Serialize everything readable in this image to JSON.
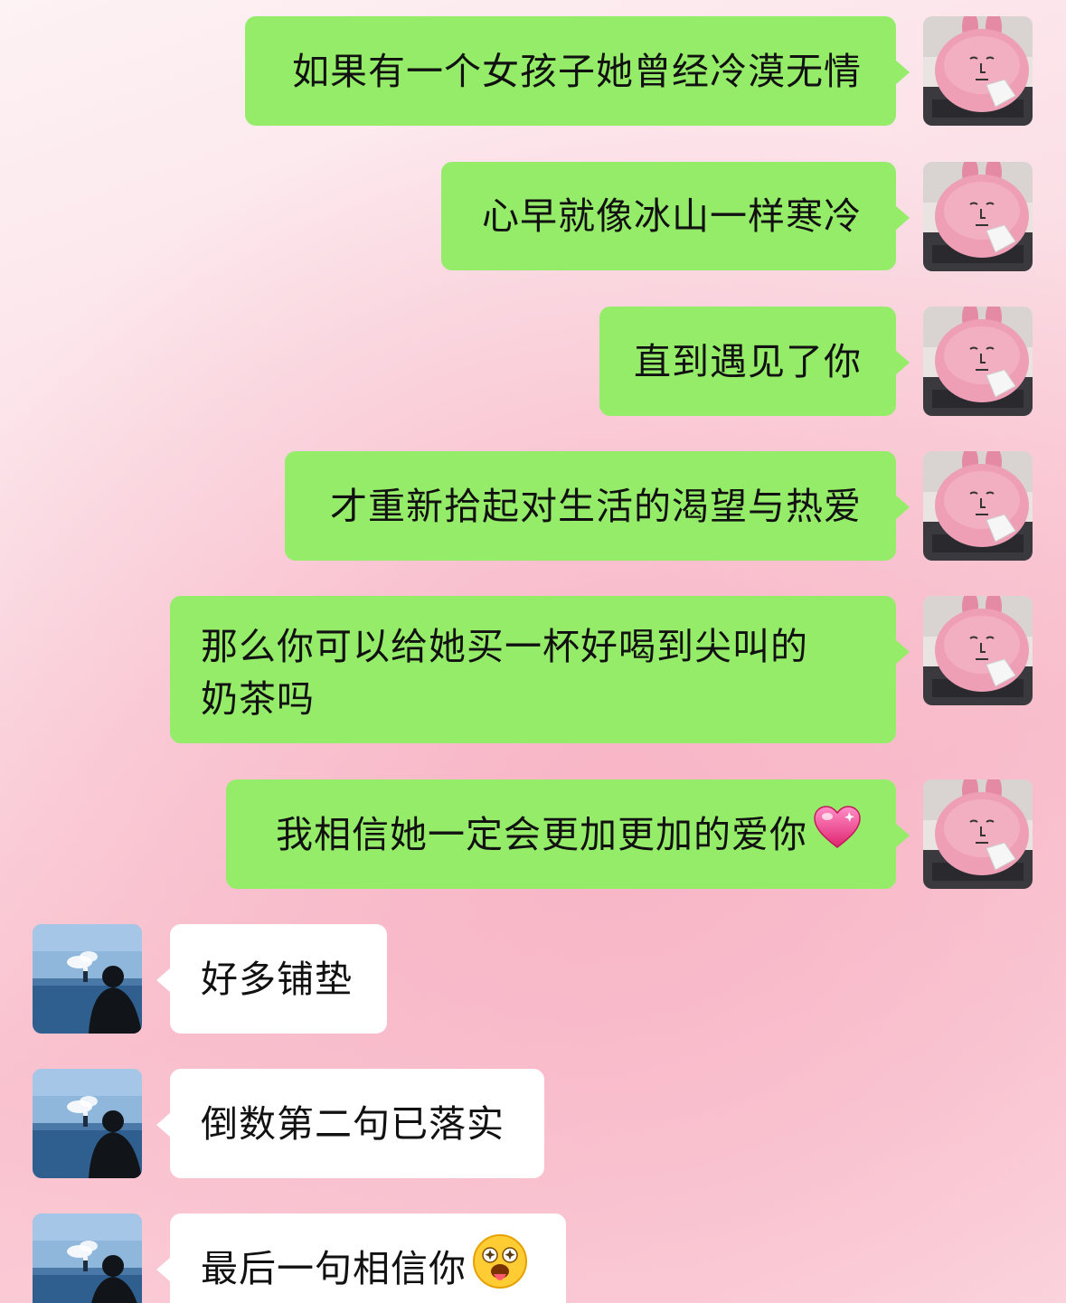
{
  "conversation": {
    "outgoing": [
      {
        "text": "如果有一个女孩子她曾经冷漠无情"
      },
      {
        "text": "心早就像冰山一样寒冷"
      },
      {
        "text": "直到遇见了你"
      },
      {
        "text": "才重新拾起对生活的渴望与热爱"
      },
      {
        "line1": "那么你可以给她买一杯好喝到尖叫的",
        "line2": "奶茶吗"
      },
      {
        "text": "我相信她一定会更加更加的爱你",
        "emoji": "pink-heart-icon"
      }
    ],
    "incoming": [
      {
        "text": "好多铺垫"
      },
      {
        "text": "倒数第二句已落实"
      },
      {
        "text": "最后一句相信你",
        "emoji": "starstruck-tongue-face-icon"
      }
    ]
  },
  "avatars": {
    "me": "pink-rabbit-plush-avatar",
    "them": "man-facing-sea-lighthouse-avatar"
  },
  "colors": {
    "outgoing_bubble": "#95ec69",
    "incoming_bubble": "#ffffff",
    "background_pink": "#f9c3cf"
  }
}
